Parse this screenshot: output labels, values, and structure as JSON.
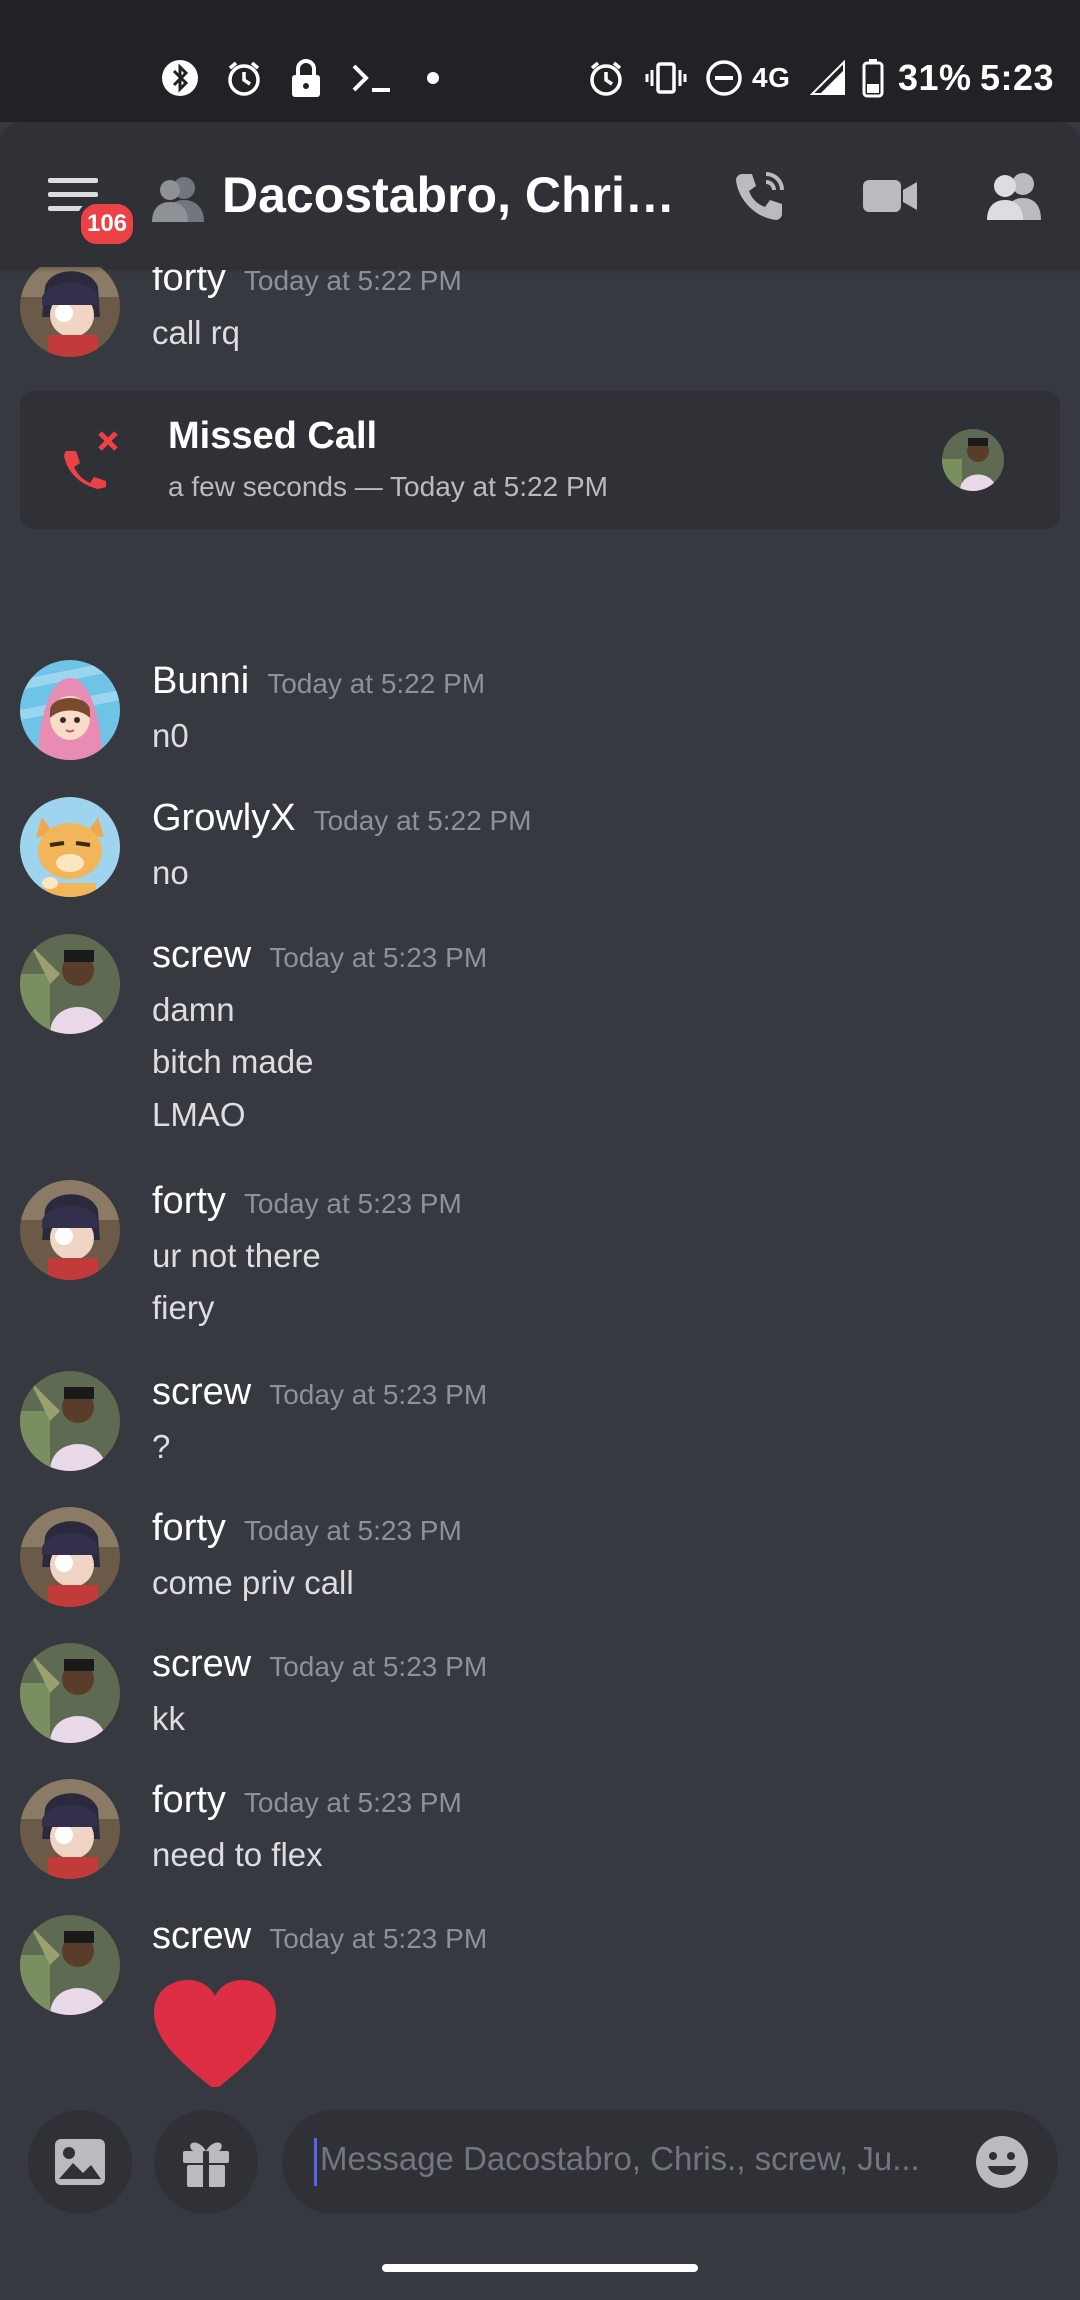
{
  "status_bar": {
    "battery": "31%",
    "time": "5:23",
    "network": "4G"
  },
  "header": {
    "unread_count": "106",
    "title": "Dacostabro, Chris.,..."
  },
  "missed_call": {
    "title": "Missed Call",
    "subtitle": "a few seconds — Today at 5:22 PM"
  },
  "messages": [
    {
      "author": "forty",
      "timestamp": "Today at 5:22 PM",
      "lines": [
        "call rq"
      ]
    },
    {
      "author": "Bunni",
      "timestamp": "Today at 5:22 PM",
      "lines": [
        "n0"
      ]
    },
    {
      "author": "GrowlyX",
      "timestamp": "Today at 5:22 PM",
      "lines": [
        "no"
      ]
    },
    {
      "author": "screw",
      "timestamp": "Today at 5:23 PM",
      "lines": [
        "damn",
        "bitch made",
        "LMAO"
      ]
    },
    {
      "author": "forty",
      "timestamp": "Today at 5:23 PM",
      "lines": [
        "ur not there",
        "fiery"
      ]
    },
    {
      "author": "screw",
      "timestamp": "Today at 5:23 PM",
      "lines": [
        "?"
      ]
    },
    {
      "author": "forty",
      "timestamp": "Today at 5:23 PM",
      "lines": [
        "come priv call"
      ]
    },
    {
      "author": "screw",
      "timestamp": "Today at 5:23 PM",
      "lines": [
        "kk"
      ]
    },
    {
      "author": "forty",
      "timestamp": "Today at 5:23 PM",
      "lines": [
        "need to flex"
      ]
    },
    {
      "author": "screw",
      "timestamp": "Today at 5:23 PM",
      "lines": [],
      "emoji": "heart"
    }
  ],
  "input": {
    "placeholder": "Message Dacostabro, Chris., screw, Ju..."
  },
  "colors": {
    "background": "#36393f",
    "header": "#2f3136",
    "status_bar": "#202225",
    "missed_call_red": "#ed4245",
    "heart": "#dd2e44",
    "accent": "#5865f2"
  }
}
